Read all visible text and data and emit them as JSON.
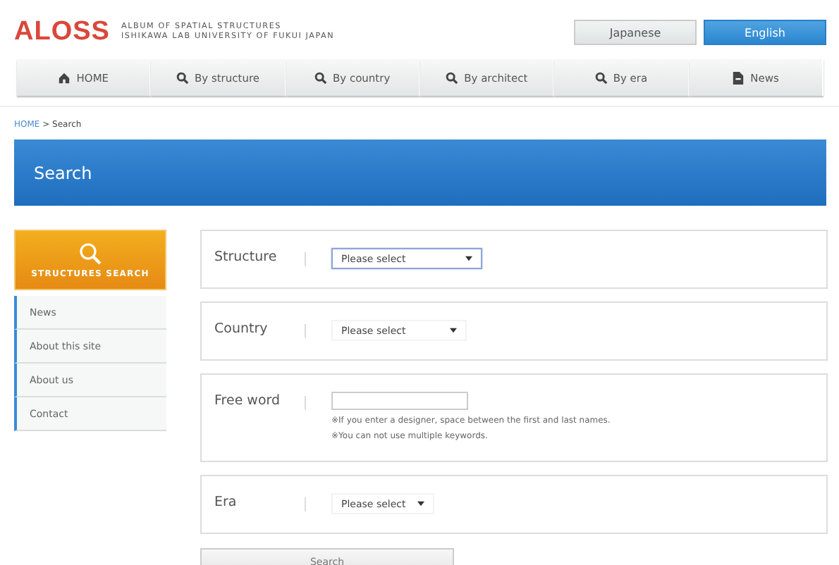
{
  "header": {
    "logo": "ALOSS",
    "tagline": [
      "ALBUM OF SPATIAL STRUCTURES",
      "ISHIKAWA LAB UNIVERSITY OF FUKUI JAPAN"
    ],
    "languages": [
      {
        "label": "Japanese",
        "selected": false
      },
      {
        "label": "English",
        "selected": true
      }
    ]
  },
  "nav": [
    {
      "label": "HOME",
      "kind": "home"
    },
    {
      "label": "By structure",
      "kind": "search"
    },
    {
      "label": "By country",
      "kind": "search"
    },
    {
      "label": "By architect",
      "kind": "search"
    },
    {
      "label": "By era",
      "kind": "search"
    },
    {
      "label": "News",
      "kind": "document"
    }
  ],
  "breadcrumb": {
    "link": "HOME",
    "current": "> Search"
  },
  "banner": {
    "title": "Search"
  },
  "sidebar": {
    "feature": "STRUCTURES SEARCH",
    "items": [
      "News",
      "About this site",
      "About us",
      "Contact"
    ]
  },
  "fields": [
    {
      "kind": "select",
      "label": "Structure",
      "value": "Please select",
      "focused": true
    },
    {
      "kind": "select",
      "label": "Country",
      "value": "Please select",
      "focused": false
    },
    {
      "kind": "text",
      "label": "Free word",
      "notes": [
        "※If you enter a designer, space between the first and last names.",
        "※You can not use multiple keywords."
      ]
    },
    {
      "kind": "select",
      "label": "Era",
      "value": "Please select",
      "focused": false
    }
  ],
  "submit": "Search"
}
